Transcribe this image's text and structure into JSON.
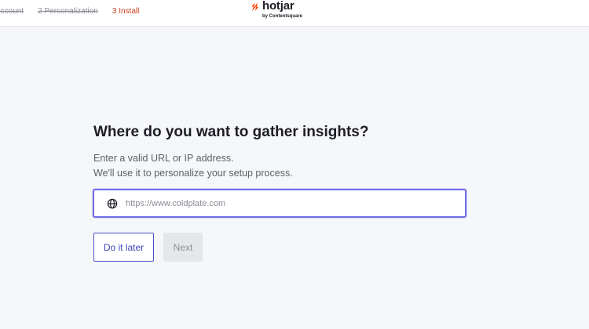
{
  "header": {
    "steps": [
      {
        "label": "Account",
        "state": "done"
      },
      {
        "label": "2 Personalization",
        "state": "done"
      },
      {
        "label": "3 Install",
        "state": "current"
      }
    ],
    "logo": {
      "name": "hotjar",
      "subtitle": "by Contentsquare",
      "icon": "hotjar-flame-icon"
    }
  },
  "main": {
    "heading": "Where do you want to gather insights?",
    "description_line1": "Enter a valid URL or IP address.",
    "description_line2": "We'll use it to personalize your setup process.",
    "url_field": {
      "value": "",
      "placeholder": "https://www.coldplate.com",
      "icon": "globe-icon"
    },
    "buttons": {
      "later_label": "Do it later",
      "next_label": "Next"
    }
  },
  "colors": {
    "accent": "#4b4fc7",
    "current_step": "#c8401f",
    "brand_orange": "#ff3c00",
    "background": "#f6f7f9"
  }
}
